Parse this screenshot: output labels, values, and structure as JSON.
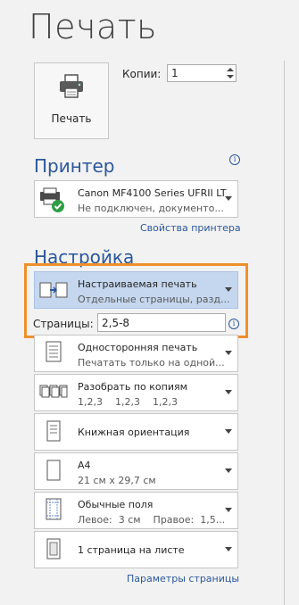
{
  "page": {
    "title": "Печать"
  },
  "print_button": {
    "label": "Печать"
  },
  "copies": {
    "label": "Копии:",
    "value": "1"
  },
  "printer": {
    "section_title": "Принтер",
    "name": "Canon MF4100 Series UFRII LT",
    "status": "Не подключен, документо...",
    "properties_link": "Свойства принтера"
  },
  "settings": {
    "section_title": "Настройка",
    "print_range": {
      "title": "Настраиваемая печать",
      "subtitle": "Отдельные страницы, разд..."
    },
    "pages": {
      "label": "Страницы:",
      "value": "2,5-8"
    },
    "sides": {
      "title": "Односторонняя печать",
      "subtitle": "Печатать только на одной..."
    },
    "collation": {
      "title": "Разобрать по копиям",
      "subtitle": "1,2,3    1,2,3    1,2,3"
    },
    "orientation": {
      "title": "Книжная ориентация"
    },
    "paper_size": {
      "title": "A4",
      "subtitle": "21 см x 29,7 см"
    },
    "margins": {
      "title": "Обычные поля",
      "subtitle": "Левое:  3 см    Правое:  1,5..."
    },
    "pages_per_sheet": {
      "title": "1 страница на листе"
    },
    "page_setup_link": "Параметры страницы"
  },
  "colors": {
    "accent": "#2b579a",
    "highlight_border": "#ef8f2b",
    "selected_bg": "#c5d7ee"
  }
}
